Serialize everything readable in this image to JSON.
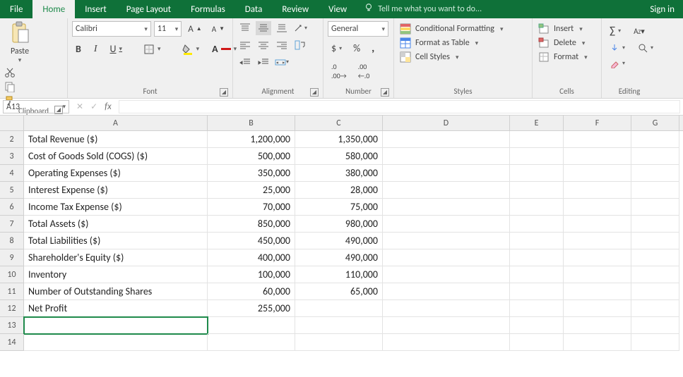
{
  "tabs": [
    "File",
    "Home",
    "Insert",
    "Page Layout",
    "Formulas",
    "Data",
    "Review",
    "View"
  ],
  "activeTab": "Home",
  "tellMe": "Tell me what you want to do...",
  "signin": "Sign in",
  "ribbon": {
    "clipboard": {
      "paste": "Paste",
      "label": "Clipboard"
    },
    "font": {
      "name": "Calibri",
      "size": "11",
      "label": "Font",
      "bold": "B",
      "italic": "I",
      "underline": "U"
    },
    "alignment": {
      "label": "Alignment"
    },
    "number": {
      "general": "General",
      "label": "Number"
    },
    "styles": {
      "cond": "Conditional Formatting",
      "table": "Format as Table",
      "cell": "Cell Styles",
      "label": "Styles"
    },
    "cells": {
      "insert": "Insert",
      "delete": "Delete",
      "format": "Format",
      "label": "Cells"
    },
    "editing": {
      "label": "Editing"
    }
  },
  "namebox": "A13",
  "columns": [
    "A",
    "B",
    "C",
    "D",
    "E",
    "F",
    "G"
  ],
  "rows": [
    {
      "n": "2",
      "a": "Total Revenue ($)",
      "b": "1,200,000",
      "c": "1,350,000"
    },
    {
      "n": "3",
      "a": "Cost of Goods Sold (COGS) ($)",
      "b": "500,000",
      "c": "580,000"
    },
    {
      "n": "4",
      "a": "Operating Expenses ($)",
      "b": "350,000",
      "c": "380,000"
    },
    {
      "n": "5",
      "a": "Interest Expense ($)",
      "b": "25,000",
      "c": "28,000"
    },
    {
      "n": "6",
      "a": "Income Tax Expense ($)",
      "b": "70,000",
      "c": "75,000"
    },
    {
      "n": "7",
      "a": "Total Assets ($)",
      "b": "850,000",
      "c": "980,000"
    },
    {
      "n": "8",
      "a": "Total Liabilities ($)",
      "b": "450,000",
      "c": "490,000"
    },
    {
      "n": "9",
      "a": "Shareholder's Equity ($)",
      "b": "400,000",
      "c": "490,000"
    },
    {
      "n": "10",
      "a": "Inventory",
      "b": "100,000",
      "c": "110,000"
    },
    {
      "n": "11",
      "a": "Number of Outstanding Shares",
      "b": "60,000",
      "c": "65,000"
    },
    {
      "n": "12",
      "a": "Net Profit",
      "b": "255,000",
      "c": ""
    },
    {
      "n": "13",
      "a": "",
      "b": "",
      "c": ""
    },
    {
      "n": "14",
      "a": "",
      "b": "",
      "c": ""
    }
  ]
}
